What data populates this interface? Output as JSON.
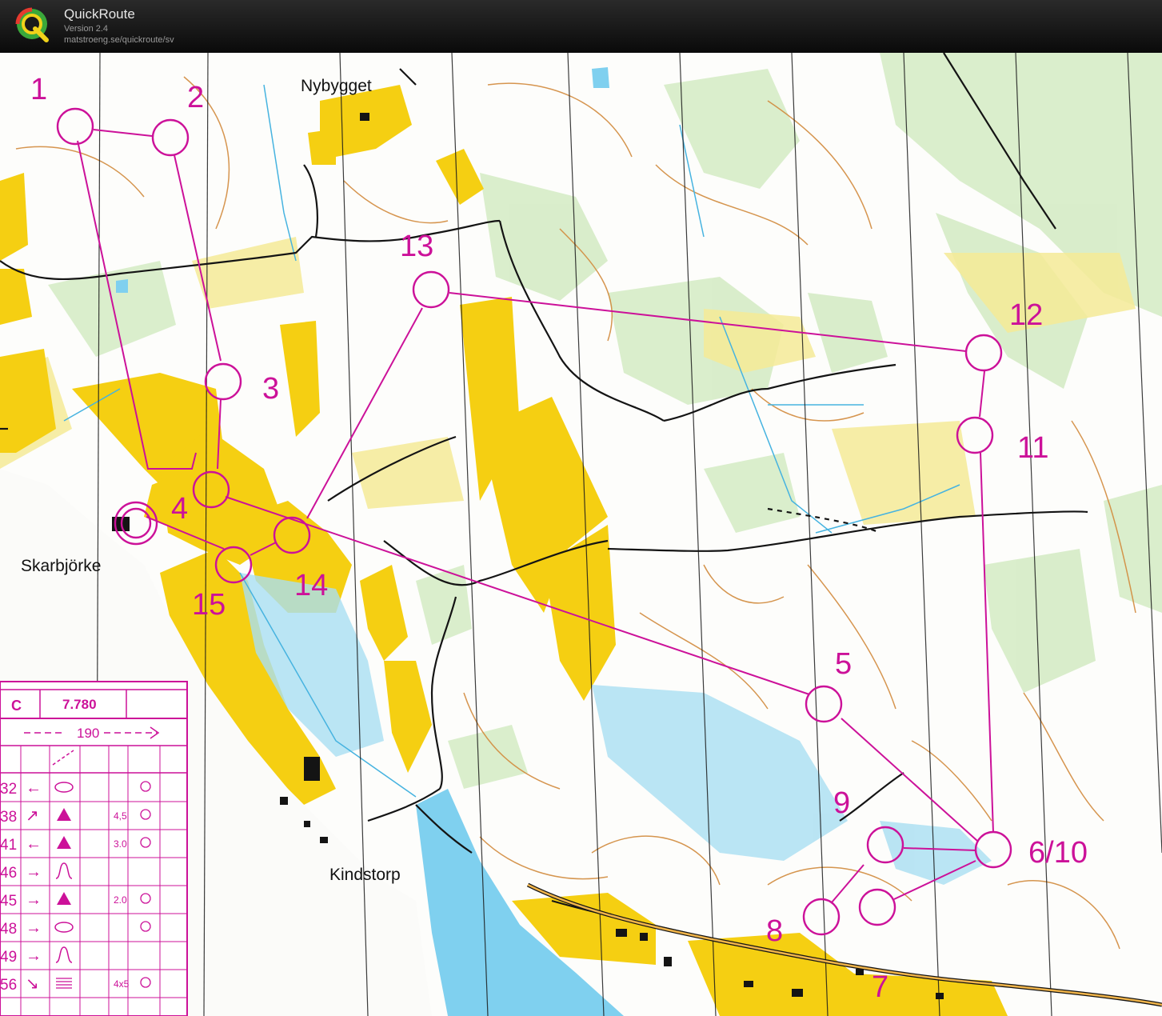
{
  "app": {
    "name": "QuickRoute",
    "version": "Version 2.4",
    "url": "matstroeng.se/quickroute/sv",
    "logo_letter": "Q"
  },
  "map": {
    "place_names": [
      "Nybygget",
      "Skarbjörke",
      "Kindstorp"
    ],
    "controls": [
      "1",
      "2",
      "3",
      "4",
      "5",
      "6/10",
      "7",
      "8",
      "9",
      "11",
      "12",
      "13",
      "14",
      "15"
    ],
    "course_color": "#cc1199",
    "colors": {
      "open_land": "#f5cf12",
      "forest_light_green": "#d3ecc4",
      "marsh_blue": "#8fd3ec",
      "water": "#7fd0ef",
      "contour_brown": "#d18a3c",
      "path_black": "#141414"
    }
  },
  "description_sheet": {
    "course_code": "C",
    "length": "7.780",
    "climb": "190",
    "rows": [
      {
        "code": "32",
        "arrow": "←",
        "extra": ""
      },
      {
        "code": "38",
        "arrow": "↗",
        "extra": "4,5"
      },
      {
        "code": "41",
        "arrow": "←",
        "extra": "3.0"
      },
      {
        "code": "46",
        "arrow": "→",
        "extra": ""
      },
      {
        "code": "45",
        "arrow": "→",
        "extra": "2.0"
      },
      {
        "code": "48",
        "arrow": "→",
        "extra": ""
      },
      {
        "code": "49",
        "arrow": "→",
        "extra": ""
      },
      {
        "code": "56",
        "arrow": "↘",
        "extra": "4x5"
      }
    ]
  }
}
